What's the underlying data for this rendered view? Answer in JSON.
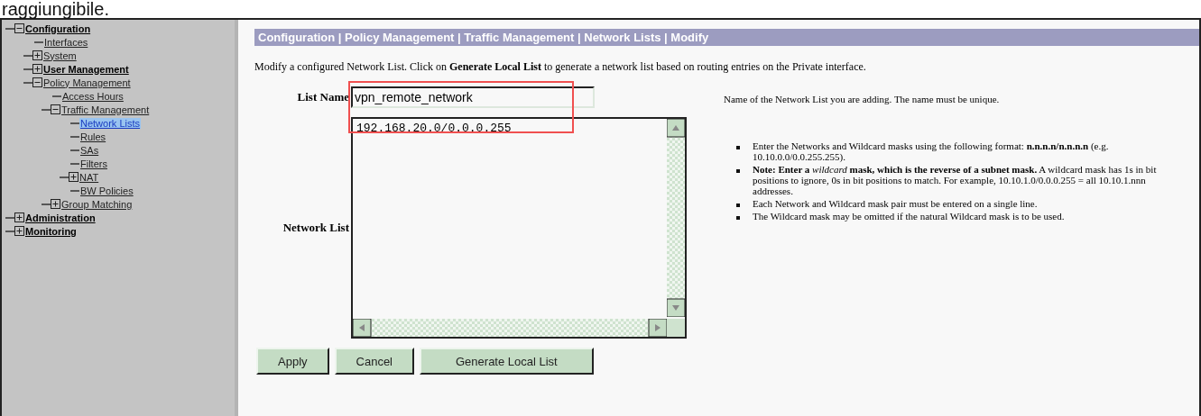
{
  "caption": "raggiungibile.",
  "tree": [
    {
      "label": "Configuration",
      "bold": true,
      "expanded": true,
      "selected": false,
      "children": [
        {
          "label": "Interfaces",
          "bold": false,
          "selected": false
        },
        {
          "label": "System",
          "bold": false,
          "expanded": false,
          "selected": false
        },
        {
          "label": "User Management",
          "bold": true,
          "expanded": false,
          "selected": false
        },
        {
          "label": "Policy Management",
          "bold": false,
          "expanded": true,
          "selected": false,
          "children": [
            {
              "label": "Access Hours",
              "bold": false,
              "selected": false
            },
            {
              "label": "Traffic Management",
              "bold": false,
              "expanded": true,
              "selected": false,
              "children": [
                {
                  "label": "Network Lists",
                  "bold": false,
                  "selected": true
                },
                {
                  "label": "Rules",
                  "bold": false,
                  "selected": false
                },
                {
                  "label": "SAs",
                  "bold": false,
                  "selected": false
                },
                {
                  "label": "Filters",
                  "bold": false,
                  "selected": false
                },
                {
                  "label": "NAT",
                  "bold": false,
                  "expanded": false,
                  "selected": false
                },
                {
                  "label": "BW Policies",
                  "bold": false,
                  "selected": false
                }
              ]
            },
            {
              "label": "Group Matching",
              "bold": false,
              "expanded": false,
              "selected": false
            }
          ]
        }
      ]
    },
    {
      "label": "Administration",
      "bold": true,
      "expanded": false,
      "selected": false
    },
    {
      "label": "Monitoring",
      "bold": true,
      "expanded": false,
      "selected": false
    }
  ],
  "breadcrumb": "Configuration | Policy Management | Traffic Management | Network Lists | Modify",
  "intro": "Modify a configured Network List. Click on **Generate Local List** to generate a network list based on routing entries on the Private interface.",
  "list_name": {
    "label": "List Name",
    "value": "vpn_remote_network",
    "help": "Name of the Network List you are adding. The name must be unique."
  },
  "network_list": {
    "label": "Network List",
    "value": "192.168.20.0/0.0.0.255",
    "help": [
      "Enter the Networks and Wildcard masks using the following format: **n.n.n.n/n.n.n.n** (e.g. 10.10.0.0/0.0.255.255).",
      "**Note: Enter a** *wildcard* **mask, which is the reverse of a subnet mask.** A wildcard mask has 1s in bit positions to ignore, 0s in bit positions to match. For example, 10.10.1.0/0.0.0.255 = all 10.10.1.nnn addresses.",
      "Each Network and Wildcard mask pair must be entered on a single line.",
      "The Wildcard mask may be omitted if the natural Wildcard mask is to be used."
    ]
  },
  "buttons": [
    "Apply",
    "Cancel",
    "Generate Local List"
  ]
}
